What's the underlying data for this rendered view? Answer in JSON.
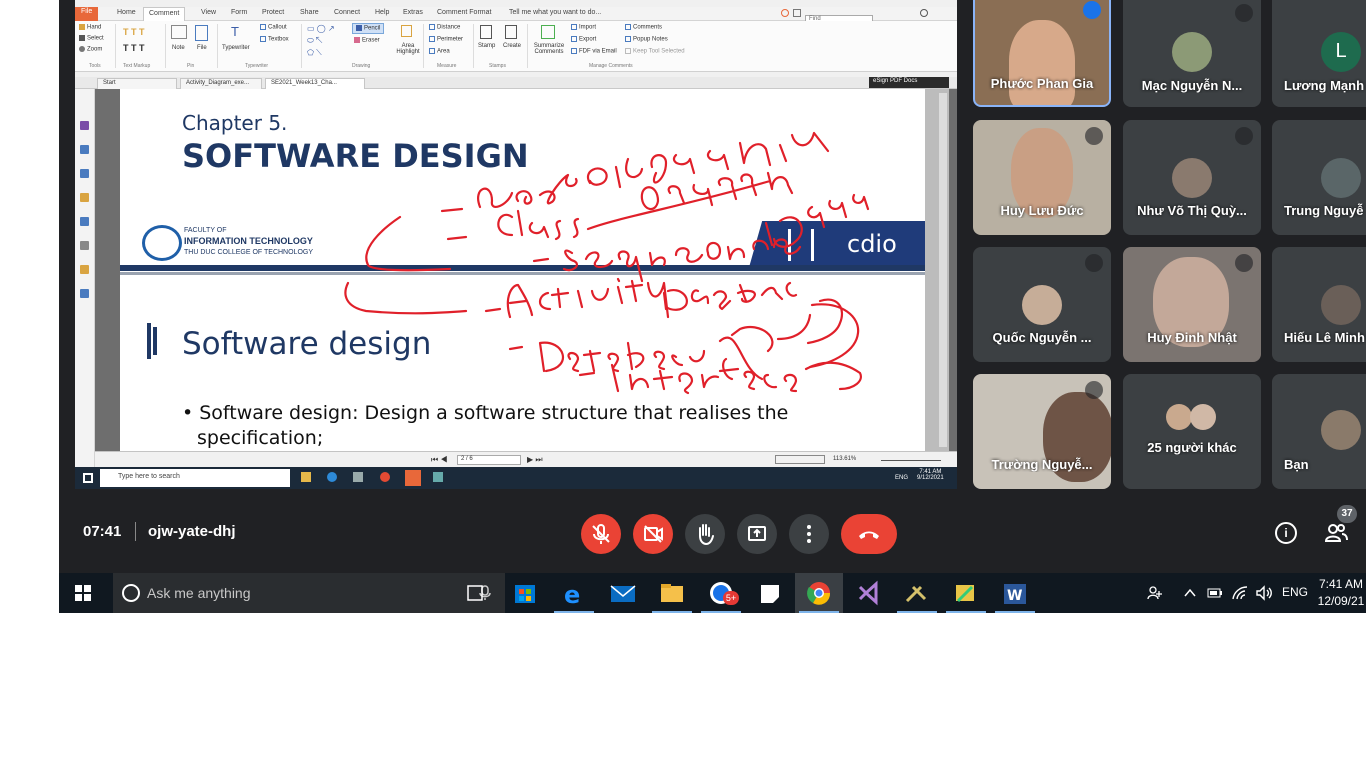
{
  "app": {
    "reader_tabs": [
      "File",
      "Home",
      "Comment",
      "View",
      "Form",
      "Protect",
      "Share",
      "Connect",
      "Help",
      "Extras",
      "Comment Format"
    ],
    "tell_me": "Tell me what you want to do...",
    "find_placeholder": "Find",
    "ribbon_items": [
      "Hand",
      "Select",
      "Zoom",
      "Note",
      "File",
      "Typewriter",
      "Callout",
      "Textbox",
      "Pencil",
      "Eraser",
      "Area Highlight",
      "Distance",
      "Perimeter",
      "Area",
      "Stamp",
      "Create",
      "Summarize Comments",
      "Import",
      "Export",
      "FDF via Email",
      "Comments",
      "Popup Notes",
      "Keep Tool Selected"
    ],
    "ribbon_groups": [
      "Tools",
      "Text Markup",
      "Pin",
      "Typewriter",
      "Drawing",
      "Measure",
      "Stamps",
      "Manage Comments"
    ],
    "doc_tabs": [
      "Start",
      "Activity_Diagram_exe...",
      "SE2021_Week13_Cha..."
    ],
    "esign": "eSign PDF Docs",
    "page_box": "2 / 6",
    "zoom": "113.61%",
    "inner_search": "Type here to search",
    "inner_time": "7:41 AM",
    "inner_date": "9/12/2021",
    "inner_lang": "ENG"
  },
  "slide": {
    "chapter": "Chapter 5.",
    "title": "SOFTWARE DESIGN",
    "faculty_line1": "FACULTY OF",
    "faculty_line2": "INFORMATION TECHNOLOGY",
    "faculty_line3": "THU DUC COLLEGE OF TECHNOLOGY",
    "cdio": "cdio",
    "section": "Software design",
    "bullet_line1": "Software design: Design a software structure that realises the",
    "bullet_line2": "specification;",
    "ink_color": "#e0202a"
  },
  "participants": [
    {
      "name": "Phước Phan Gia",
      "speaking": true
    },
    {
      "name": "Mạc Nguyễn N...",
      "muted": true
    },
    {
      "name": "Lương Mạnh",
      "initial": "L"
    },
    {
      "name": "Huy Lưu Đức",
      "muted": true
    },
    {
      "name": "Như Võ Thị Quỳ...",
      "muted": true
    },
    {
      "name": "Trung Nguyễ",
      "muted": false
    },
    {
      "name": "Quốc Nguyễn ...",
      "muted": true
    },
    {
      "name": "Huy Đinh Nhật",
      "muted": true
    },
    {
      "name": "Hiếu Lê Minh",
      "muted": false
    },
    {
      "name": "Trường Nguyễ...",
      "muted": true
    },
    {
      "name": "25 người khác"
    },
    {
      "name": "Bạn"
    }
  ],
  "meeting": {
    "time": "07:41",
    "code": "ojw-yate-dhj",
    "people_count": "37",
    "accent_red": "#ea4335"
  },
  "taskbar": {
    "cortana": "Ask me anything",
    "lang": "ENG",
    "time": "7:41 AM",
    "date": "12/09/21",
    "badge": "5+"
  }
}
